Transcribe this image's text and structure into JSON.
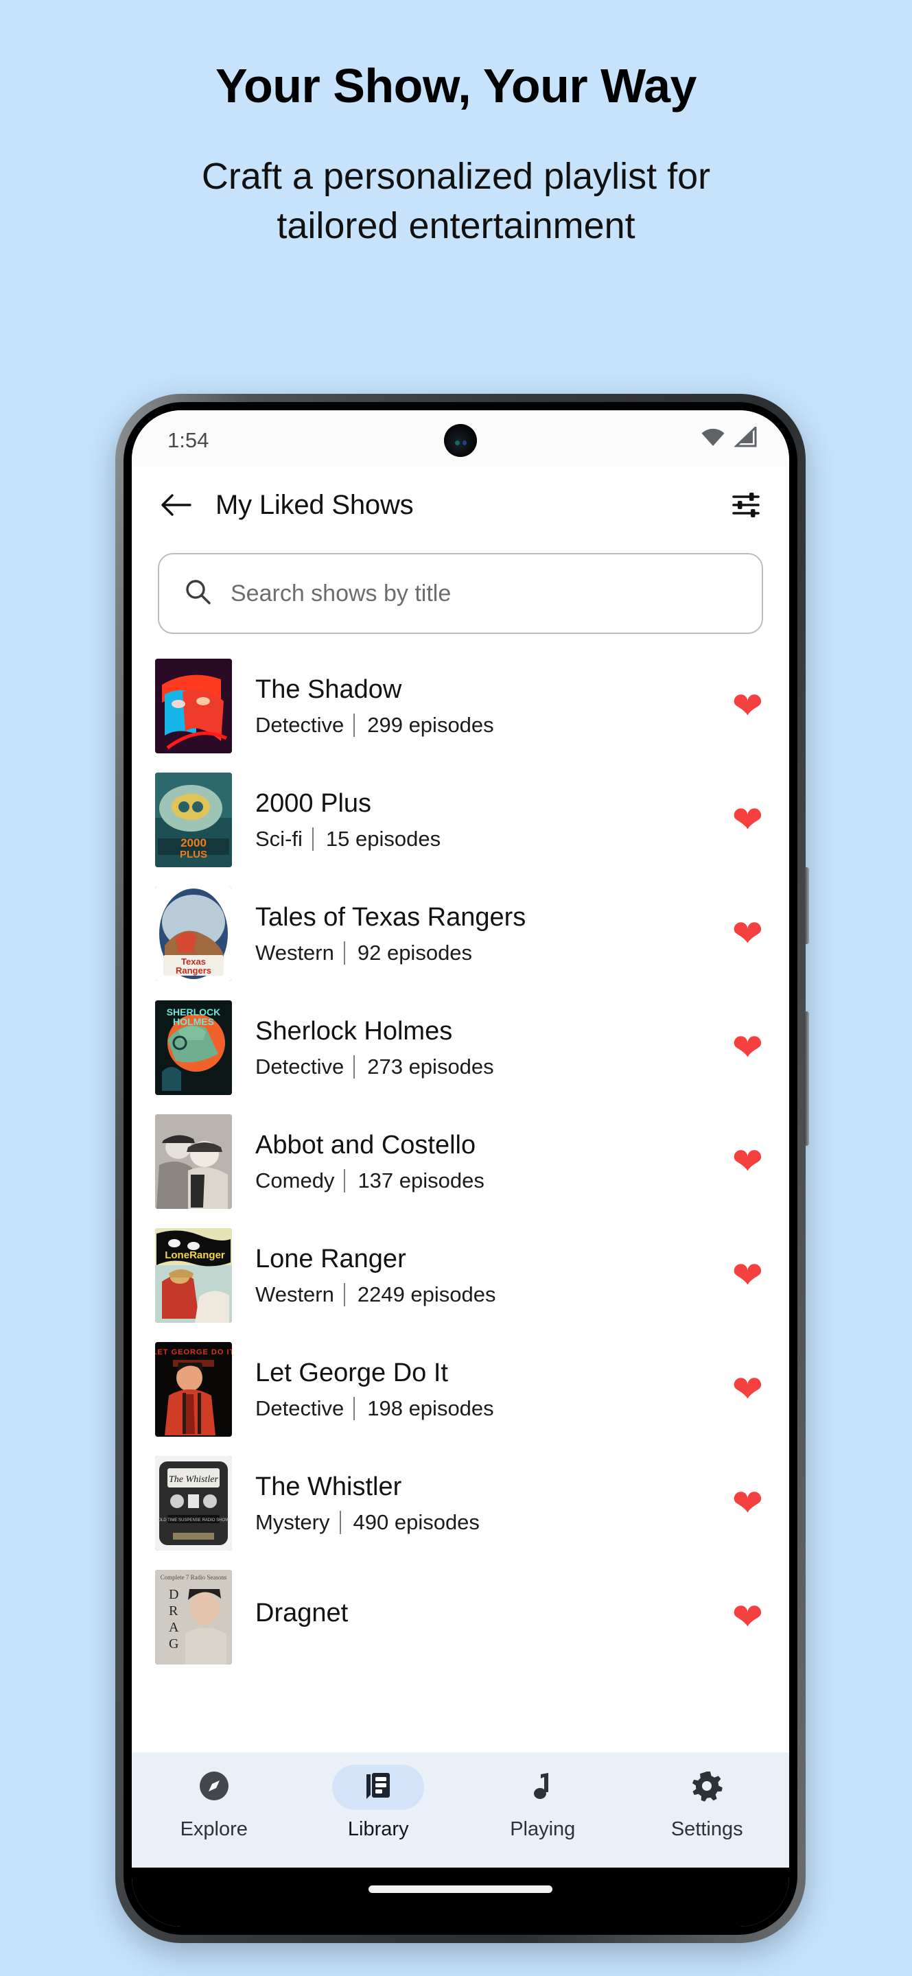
{
  "promo": {
    "title": "Your Show, Your Way",
    "subtitle": "Craft a personalized playlist for tailored entertainment",
    "background_color": "#c7e3fb"
  },
  "status_bar": {
    "time": "1:54",
    "wifi_icon": "wifi-icon",
    "signal_icon": "cellular-signal-icon"
  },
  "app_bar": {
    "back_icon": "back-arrow-icon",
    "title": "My Liked Shows",
    "filter_icon": "tune-filter-icon"
  },
  "search": {
    "icon": "search-icon",
    "placeholder": "Search shows by title",
    "value": ""
  },
  "shows": [
    {
      "title": "The Shadow",
      "genre": "Detective",
      "episodes": "299 episodes",
      "liked": true,
      "art": "shadow"
    },
    {
      "title": "2000 Plus",
      "genre": "Sci-fi",
      "episodes": "15 episodes",
      "liked": true,
      "art": "plus2000"
    },
    {
      "title": "Tales of Texas Rangers",
      "genre": "Western",
      "episodes": "92 episodes",
      "liked": true,
      "art": "texas"
    },
    {
      "title": "Sherlock Holmes",
      "genre": "Detective",
      "episodes": "273 episodes",
      "liked": true,
      "art": "sherlock"
    },
    {
      "title": "Abbot and Costello",
      "genre": "Comedy",
      "episodes": "137 episodes",
      "liked": true,
      "art": "abbot"
    },
    {
      "title": "Lone Ranger",
      "genre": "Western",
      "episodes": "2249 episodes",
      "liked": true,
      "art": "lone"
    },
    {
      "title": "Let George Do It",
      "genre": "Detective",
      "episodes": "198 episodes",
      "liked": true,
      "art": "george"
    },
    {
      "title": "The Whistler",
      "genre": "Mystery",
      "episodes": "490 episodes",
      "liked": true,
      "art": "whistler"
    },
    {
      "title": "Dragnet",
      "genre": "",
      "episodes": "",
      "liked": true,
      "art": "dragnet"
    }
  ],
  "bottom_nav": {
    "items": [
      {
        "label": "Explore",
        "icon": "compass-icon",
        "active": false
      },
      {
        "label": "Library",
        "icon": "library-icon",
        "active": true
      },
      {
        "label": "Playing",
        "icon": "music-note-icon",
        "active": false
      },
      {
        "label": "Settings",
        "icon": "gear-icon",
        "active": false
      }
    ]
  },
  "colors": {
    "heart": "#f4413f",
    "nav_active_pill": "#d3e3f8",
    "nav_background": "#eaf0f8",
    "promo_bg": "#c7e3fb"
  }
}
